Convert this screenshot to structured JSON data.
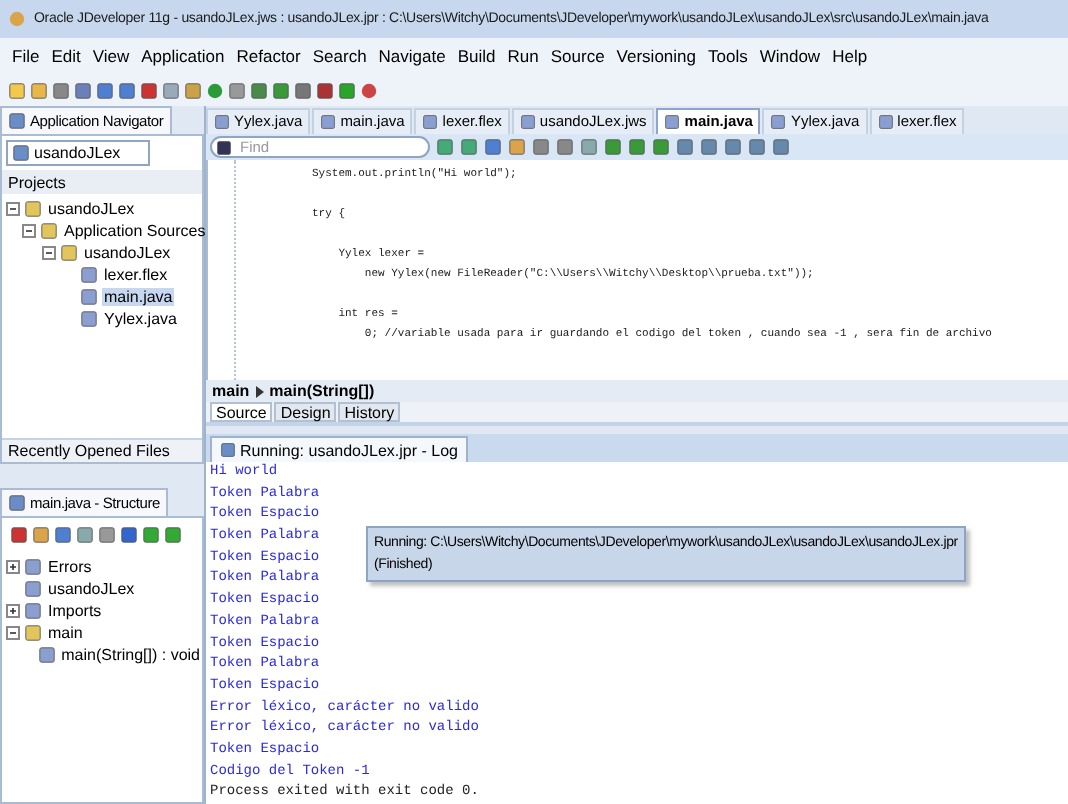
{
  "window": {
    "title": "Oracle JDeveloper 11g - usandoJLex.jws : usandoJLex.jpr : C:\\Users\\Witchy\\Documents\\JDeveloper\\mywork\\usandoJLex\\usandoJLex\\src\\usandoJLex\\main.java"
  },
  "menu": [
    "File",
    "Edit",
    "View",
    "Application",
    "Refactor",
    "Search",
    "Navigate",
    "Build",
    "Run",
    "Source",
    "Versioning",
    "Tools",
    "Window",
    "Help"
  ],
  "navigator": {
    "tab": "Application Navigator",
    "project_select": "usandoJLex",
    "projects_label": "Projects",
    "tree": [
      {
        "label": "usandoJLex",
        "expanded": true,
        "selected": false,
        "children": [
          {
            "label": "Application Sources",
            "expanded": true,
            "selected": false,
            "children": [
              {
                "label": "usandoJLex",
                "expanded": true,
                "selected": false,
                "children": [
                  {
                    "label": "lexer.flex",
                    "selected": false
                  },
                  {
                    "label": "main.java",
                    "selected": true
                  },
                  {
                    "label": "Yylex.java",
                    "selected": false
                  }
                ]
              }
            ]
          }
        ]
      }
    ],
    "recent": "Recently Opened Files"
  },
  "structure": {
    "tab": "main.java - Structure",
    "tree": [
      {
        "label": "Errors",
        "expanded": false
      },
      {
        "label": "usandoJLex"
      },
      {
        "label": "Imports",
        "expanded": false
      },
      {
        "label": "main",
        "expanded": true,
        "children": [
          {
            "label": "main(String[]) : void"
          }
        ]
      }
    ]
  },
  "editor_tabs": [
    {
      "label": "Yylex.java",
      "selected": false
    },
    {
      "label": "main.java",
      "selected": false
    },
    {
      "label": "lexer.flex",
      "selected": false
    },
    {
      "label": "usandoJLex.jws",
      "selected": false
    },
    {
      "label": "main.java",
      "selected": true
    },
    {
      "label": "Yylex.java",
      "selected": false
    },
    {
      "label": "lexer.flex",
      "selected": false
    }
  ],
  "find": {
    "placeholder": "Find"
  },
  "code": [
    {
      "text": "System.out.println(\"Hi world\");",
      "spaced": false
    },
    {
      "text": "try {",
      "spaced": true
    },
    {
      "text": "    Yylex lexer =",
      "spaced": true
    },
    {
      "text": "        new Yylex(new FileReader(\"C:\\\\Users\\\\Witchy\\\\Desktop\\\\prueba.txt\"));",
      "spaced": false
    },
    {
      "text": "    int res =",
      "spaced": true
    },
    {
      "text": "        0; //variable usada para ir guardando el codigo del token , cuando sea -1 , sera fin de archivo",
      "spaced": false
    }
  ],
  "breadcrumb": [
    "main",
    "main(String[])"
  ],
  "view_tabs": [
    {
      "label": "Source",
      "selected": true
    },
    {
      "label": "Design",
      "selected": false
    },
    {
      "label": "History",
      "selected": false
    }
  ],
  "log": {
    "tab": "Running: usandoJLex.jpr - Log",
    "lines": [
      {
        "text": "Hi world",
        "kind": "output"
      },
      {
        "text": "Token Palabra",
        "kind": "output"
      },
      {
        "text": "Token Espacio",
        "kind": "output"
      },
      {
        "text": "Token Palabra",
        "kind": "output"
      },
      {
        "text": "Token Espacio",
        "kind": "output"
      },
      {
        "text": "Token Palabra",
        "kind": "output"
      },
      {
        "text": "Token Espacio",
        "kind": "output"
      },
      {
        "text": "Token Palabra",
        "kind": "output"
      },
      {
        "text": "Token Espacio",
        "kind": "output"
      },
      {
        "text": "Token Palabra",
        "kind": "output"
      },
      {
        "text": "Token Espacio",
        "kind": "output"
      },
      {
        "text": "Error léxico, carácter no valido",
        "kind": "output"
      },
      {
        "text": "Error léxico, carácter no valido",
        "kind": "output"
      },
      {
        "text": "Token Espacio",
        "kind": "output"
      },
      {
        "text": "Codigo del Token -1",
        "kind": "output"
      },
      {
        "text": "Process exited with exit code 0.",
        "kind": "system"
      }
    ],
    "tooltip": [
      "Running: C:\\Users\\Witchy\\Documents\\JDeveloper\\mywork\\usandoJLex\\usandoJLex\\usandoJLex.jpr",
      "(Finished)"
    ]
  }
}
